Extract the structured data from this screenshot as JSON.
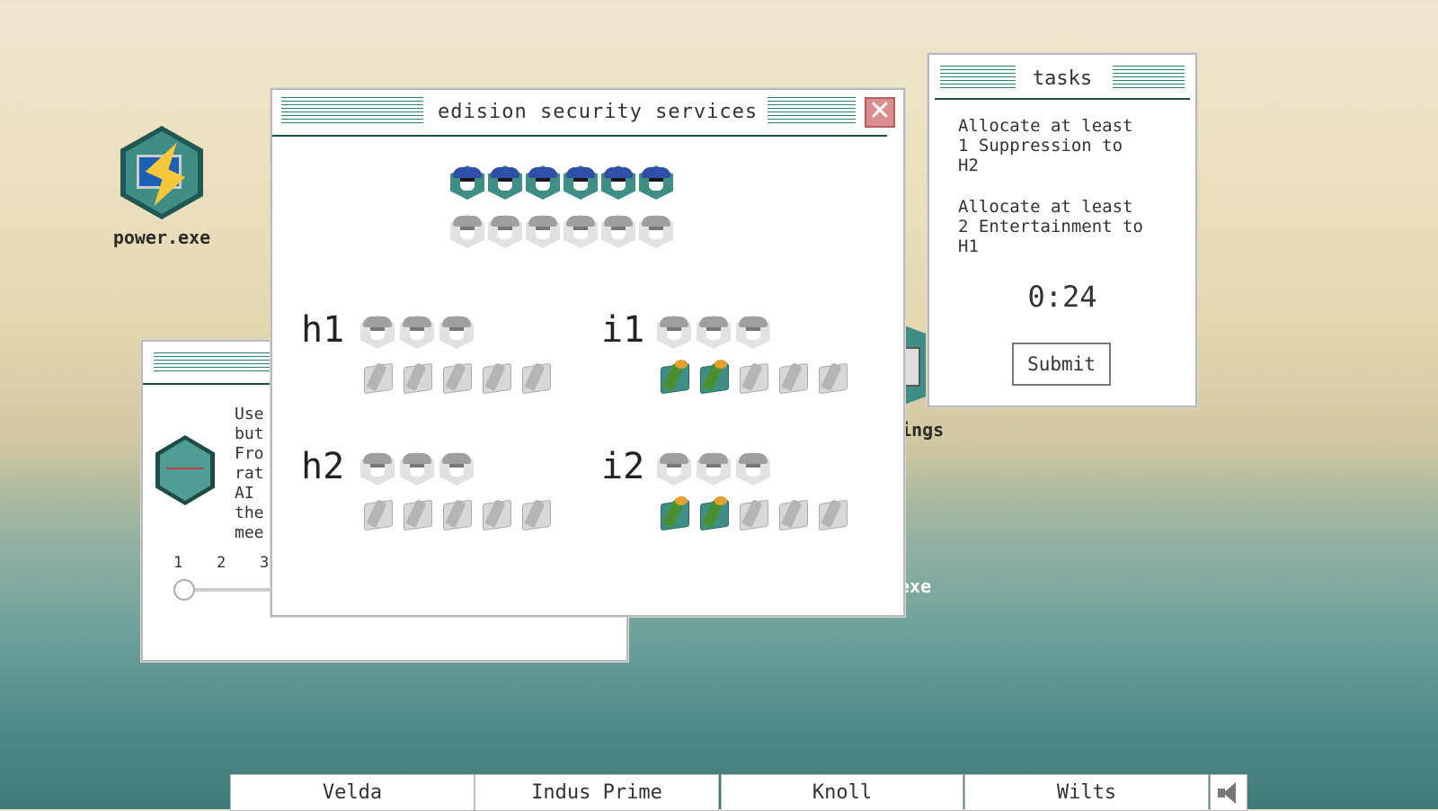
{
  "desktop": {
    "icons": [
      {
        "label": "power.exe"
      },
      {
        "label": "tings"
      },
      {
        "label": "exe"
      }
    ]
  },
  "background_window": {
    "text_lines": [
      "Use",
      "but",
      "Fro",
      "rat",
      "AI",
      "the",
      "mee"
    ],
    "slider": {
      "ticks": [
        "1",
        "2",
        "3"
      ],
      "value": 1
    }
  },
  "security_window": {
    "title": "edision security services",
    "pool": {
      "agents_total": 6,
      "agents_active": 6,
      "agents_placeholder": 6
    },
    "zones": [
      {
        "label": "h1",
        "agents_filled": 0,
        "agents_slots": 3,
        "supplies_filled": 0,
        "supplies_slots": 5
      },
      {
        "label": "i1",
        "agents_filled": 0,
        "agents_slots": 3,
        "supplies_filled": 2,
        "supplies_slots": 5
      },
      {
        "label": "h2",
        "agents_filled": 0,
        "agents_slots": 3,
        "supplies_filled": 0,
        "supplies_slots": 5
      },
      {
        "label": "i2",
        "agents_filled": 0,
        "agents_slots": 3,
        "supplies_filled": 2,
        "supplies_slots": 5
      }
    ]
  },
  "tasks_window": {
    "title": "tasks",
    "task1": "Allocate at least\n1 Suppression to\nH2",
    "task2": "Allocate at least\n2 Entertainment to\nH1",
    "timer": "0:24",
    "submit_label": "Submit"
  },
  "taskbar": {
    "tabs": [
      "Velda",
      "Indus Prime",
      "Knoll",
      "Wilts"
    ],
    "sound_icon": "speaker-icon"
  },
  "colors": {
    "accent": "#1e4b45",
    "agent_blue": "#2f4fa8",
    "agent_teal": "#3f8e86",
    "inactive_gray": "#cfcfcf",
    "close_red": "#d98f8f"
  }
}
